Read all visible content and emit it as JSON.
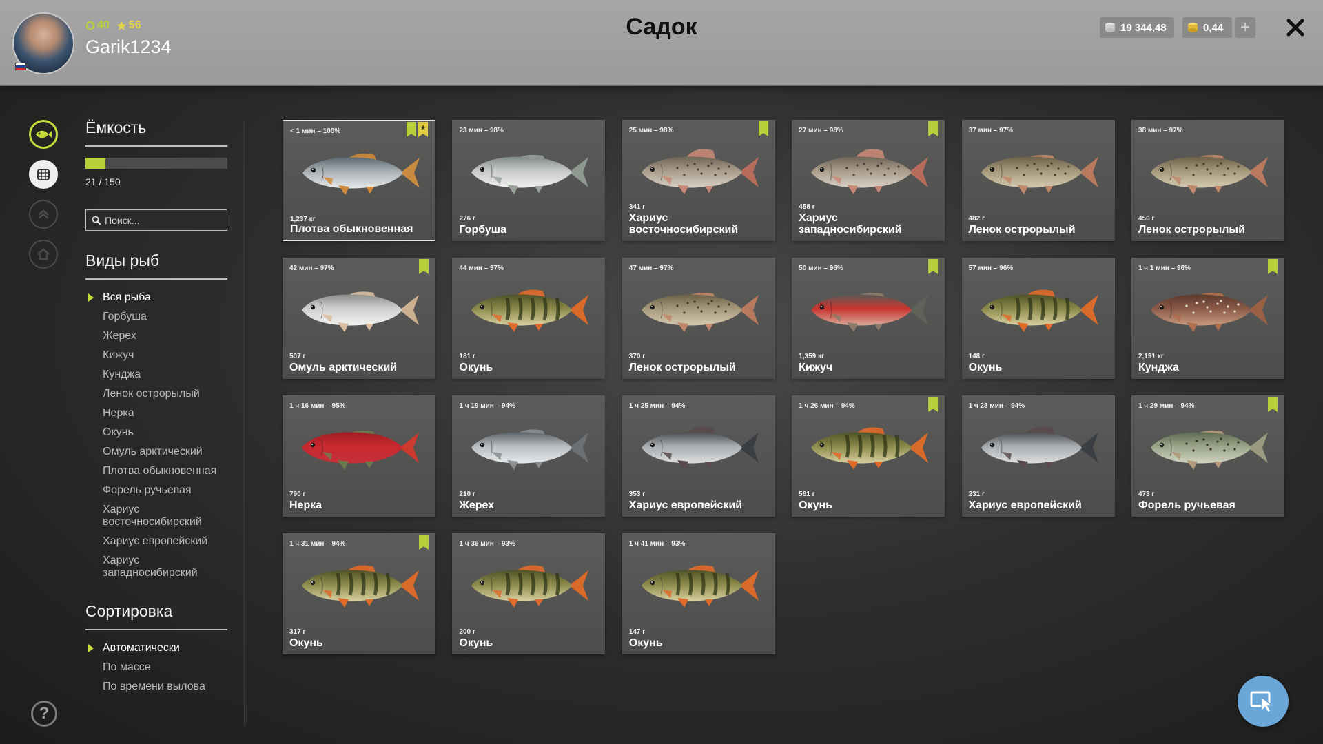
{
  "header": {
    "title": "Садок",
    "player": {
      "level": "40",
      "rank": "56",
      "name": "Garik1234"
    },
    "currency": {
      "silver": "19 344,48",
      "gold": "0,44"
    },
    "add_label": "+",
    "close_label": "✕"
  },
  "sidebar": {
    "capacity_title": "Ёмкость",
    "capacity_text": "21 / 150",
    "capacity_fraction": 0.14,
    "search_placeholder": "Поиск...",
    "species_title": "Виды рыб",
    "species": [
      {
        "label": "Вся рыба",
        "active": true
      },
      {
        "label": "Горбуша"
      },
      {
        "label": "Жерех"
      },
      {
        "label": "Кижуч"
      },
      {
        "label": "Кунджа"
      },
      {
        "label": "Ленок острорылый"
      },
      {
        "label": "Нерка"
      },
      {
        "label": "Окунь"
      },
      {
        "label": "Омуль арктический"
      },
      {
        "label": "Плотва обыкновенная"
      },
      {
        "label": "Форель ручьевая"
      },
      {
        "label": "Хариус восточносибирский"
      },
      {
        "label": "Хариус европейский"
      },
      {
        "label": "Хариус западносибирский"
      }
    ],
    "sort_title": "Сортировка",
    "sort": [
      {
        "label": "Автоматически",
        "active": true
      },
      {
        "label": "По массе"
      },
      {
        "label": "По времени вылова"
      }
    ],
    "help_label": "?"
  },
  "fish": [
    {
      "time": "< 1 мин – 100%",
      "weight": "1,237 кг",
      "name": "Плотва обыкновенная",
      "kind": "roach",
      "selected": true,
      "badges": [
        "bookmark",
        "star"
      ]
    },
    {
      "time": "23 мин – 98%",
      "weight": "276 г",
      "name": "Горбуша",
      "kind": "pink",
      "badges": []
    },
    {
      "time": "25 мин – 98%",
      "weight": "341 г",
      "name": "Хариус восточносибирский",
      "kind": "grayling",
      "badges": [
        "bookmark"
      ]
    },
    {
      "time": "27 мин – 98%",
      "weight": "458 г",
      "name": "Хариус западносибирский",
      "kind": "grayling",
      "badges": [
        "bookmark"
      ]
    },
    {
      "time": "37 мин – 97%",
      "weight": "482 г",
      "name": "Ленок острорылый",
      "kind": "lenok",
      "badges": []
    },
    {
      "time": "38 мин – 97%",
      "weight": "450 г",
      "name": "Ленок острорылый",
      "kind": "lenok",
      "badges": []
    },
    {
      "time": "42 мин – 97%",
      "weight": "507 г",
      "name": "Омуль арктический",
      "kind": "omul",
      "badges": [
        "bookmark"
      ]
    },
    {
      "time": "44 мин – 97%",
      "weight": "181 г",
      "name": "Окунь",
      "kind": "perch",
      "badges": []
    },
    {
      "time": "47 мин – 97%",
      "weight": "370 г",
      "name": "Ленок острорылый",
      "kind": "lenok",
      "badges": []
    },
    {
      "time": "50 мин – 96%",
      "weight": "1,359 кг",
      "name": "Кижуч",
      "kind": "coho",
      "badges": [
        "bookmark"
      ]
    },
    {
      "time": "57 мин – 96%",
      "weight": "148 г",
      "name": "Окунь",
      "kind": "perch",
      "badges": []
    },
    {
      "time": "1 ч 1 мин – 96%",
      "weight": "2,191 кг",
      "name": "Кунджа",
      "kind": "kundzha",
      "badges": [
        "bookmark"
      ]
    },
    {
      "time": "1 ч 16 мин – 95%",
      "weight": "790 г",
      "name": "Нерка",
      "kind": "sockeye",
      "badges": []
    },
    {
      "time": "1 ч 19 мин – 94%",
      "weight": "210 г",
      "name": "Жерех",
      "kind": "asp",
      "badges": []
    },
    {
      "time": "1 ч 25 мин – 94%",
      "weight": "353 г",
      "name": "Хариус европейский",
      "kind": "eurograyling",
      "badges": []
    },
    {
      "time": "1 ч 26 мин – 94%",
      "weight": "581 г",
      "name": "Окунь",
      "kind": "perch",
      "badges": [
        "bookmark"
      ]
    },
    {
      "time": "1 ч 28 мин – 94%",
      "weight": "231 г",
      "name": "Хариус европейский",
      "kind": "eurograyling",
      "badges": []
    },
    {
      "time": "1 ч 29 мин – 94%",
      "weight": "473 г",
      "name": "Форель ручьевая",
      "kind": "trout",
      "badges": [
        "bookmark"
      ]
    },
    {
      "time": "1 ч 31 мин – 94%",
      "weight": "317 г",
      "name": "Окунь",
      "kind": "perch",
      "badges": [
        "bookmark"
      ]
    },
    {
      "time": "1 ч 36 мин – 93%",
      "weight": "200 г",
      "name": "Окунь",
      "kind": "perch",
      "badges": []
    },
    {
      "time": "1 ч 41 мин – 93%",
      "weight": "147 г",
      "name": "Окунь",
      "kind": "perch",
      "badges": []
    }
  ],
  "colors": {
    "accent": "#b7d13a",
    "star": "#e0cc3a",
    "cursor_button": "#6aa7d8"
  },
  "icons": [
    "fish-icon",
    "keepnet-icon",
    "rank-icon",
    "home-icon",
    "search-icon",
    "coin-silver-icon",
    "coin-gold-icon",
    "close-icon",
    "help-icon",
    "cursor-icon",
    "bookmark-icon",
    "star-icon"
  ]
}
